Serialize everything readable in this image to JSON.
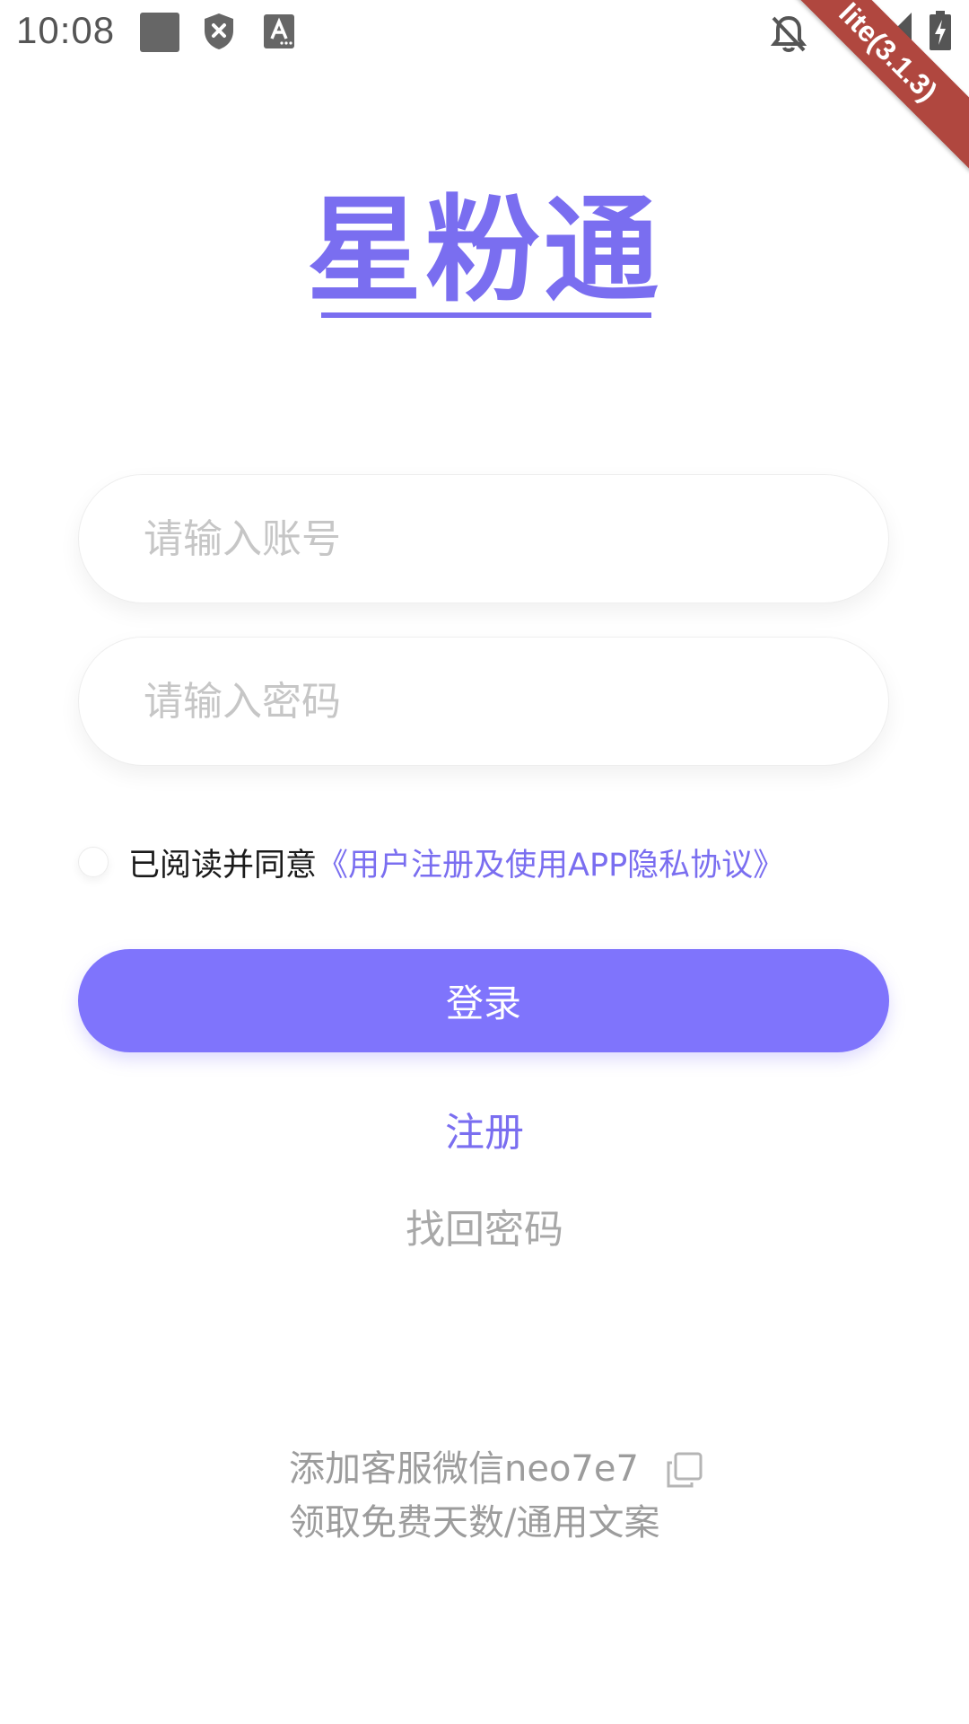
{
  "status_bar": {
    "time": "10:08",
    "ribbon_text": "lite(3.1.3)",
    "icons": [
      "gallery-placeholder-icon",
      "shield-x-icon",
      "text-a-icon",
      "bell-off-icon",
      "wifi-icon",
      "signal-icon",
      "battery-charging-icon"
    ]
  },
  "logo": {
    "text": "星粉通",
    "color": "#7a6ef0"
  },
  "login_form": {
    "account_placeholder": "请输入账号",
    "password_placeholder": "请输入密码",
    "agree_text": "已阅读并同意",
    "agree_link": "《用户注册及使用APP隐私协议》",
    "login_label": "登录",
    "register_label": "注册",
    "forgot_label": "找回密码"
  },
  "footer": {
    "line1": "添加客服微信neo7e7",
    "line2": "领取免费天数/通用文案"
  },
  "colors": {
    "accent": "#7f74fc",
    "link": "#7a6ef0",
    "muted": "#a8a8a8"
  }
}
